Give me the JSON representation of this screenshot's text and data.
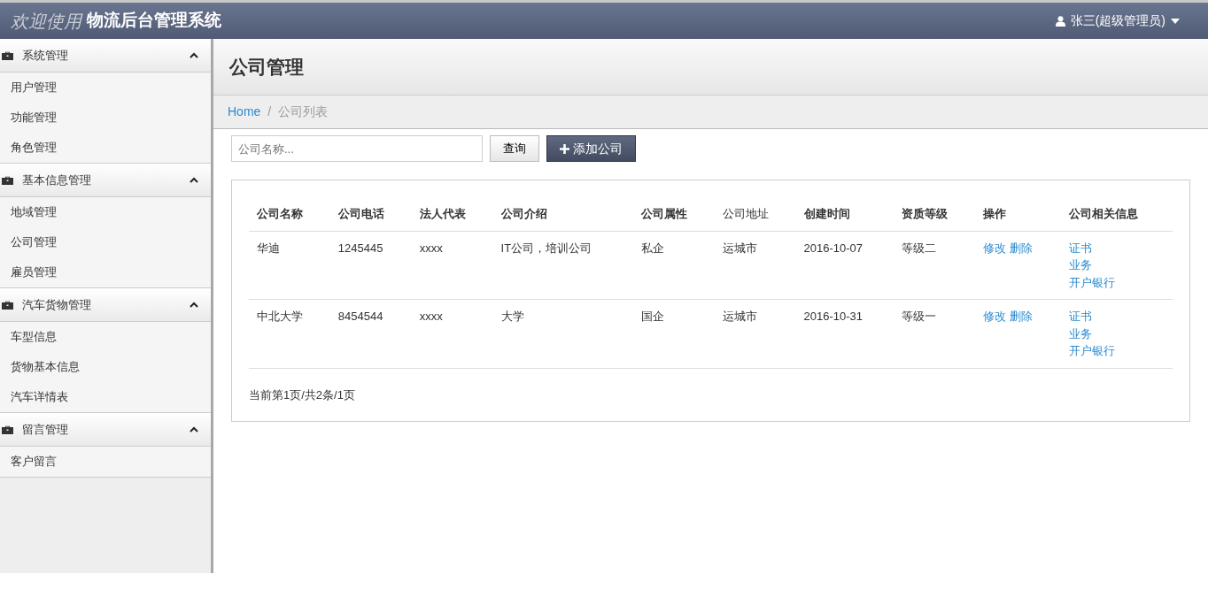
{
  "header": {
    "welcome": "欢迎使用",
    "system_name": "物流后台管理系统",
    "user": "张三(超级管理员)"
  },
  "sidebar": {
    "groups": [
      {
        "title": "系统管理",
        "expanded": true,
        "items": [
          "用户管理",
          "功能管理",
          "角色管理"
        ]
      },
      {
        "title": "基本信息管理",
        "expanded": true,
        "items": [
          "地域管理",
          "公司管理",
          "雇员管理"
        ]
      },
      {
        "title": "汽车货物管理",
        "expanded": true,
        "items": [
          "车型信息",
          "货物基本信息",
          "汽车详情表"
        ]
      },
      {
        "title": "留言管理",
        "expanded": true,
        "items": [
          "客户留言"
        ]
      }
    ]
  },
  "page_title": "公司管理",
  "breadcrumb": {
    "items": [
      "Home",
      "公司列表"
    ],
    "separator": "/"
  },
  "search": {
    "placeholder": "公司名称...",
    "button": "查询",
    "add_button": "添加公司"
  },
  "table": {
    "columns": [
      {
        "label": "公司名称",
        "bold": true
      },
      {
        "label": "公司电话",
        "bold": true
      },
      {
        "label": "法人代表",
        "bold": true
      },
      {
        "label": "公司介绍",
        "bold": true
      },
      {
        "label": "公司属性",
        "bold": true
      },
      {
        "label": "公司地址",
        "bold": false
      },
      {
        "label": "创建时间",
        "bold": true
      },
      {
        "label": "资质等级",
        "bold": true
      },
      {
        "label": "操作",
        "bold": true
      },
      {
        "label": "公司相关信息",
        "bold": true
      }
    ],
    "rows": [
      {
        "cells": [
          "华迪",
          "1245445",
          "xxxx",
          "IT公司，培训公司",
          "私企",
          "运城市",
          "2016-10-07",
          "等级二"
        ],
        "actions": [
          "修改",
          "删除"
        ],
        "info_links": [
          "证书",
          "业务",
          "开户银行"
        ]
      },
      {
        "cells": [
          "中北大学",
          "8454544",
          "xxxx",
          "大学",
          "国企",
          "运城市",
          "2016-10-31",
          "等级一"
        ],
        "actions": [
          "修改",
          "删除"
        ],
        "info_links": [
          "证书",
          "业务",
          "开户银行"
        ]
      }
    ]
  },
  "pagination": "当前第1页/共2条/1页"
}
